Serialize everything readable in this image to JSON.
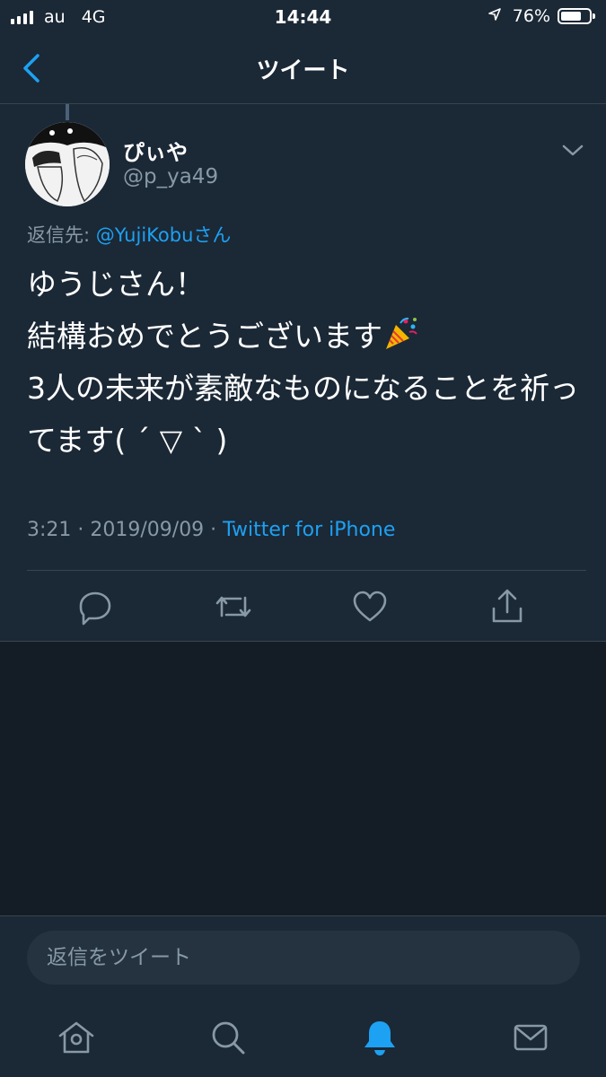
{
  "status_bar": {
    "carrier": "au",
    "network": "4G",
    "time": "14:44",
    "battery": "76%",
    "battery_level": 0.76
  },
  "header": {
    "title": "ツイート",
    "back_icon": "chevron-left-icon"
  },
  "tweet": {
    "display_name": "ぴぃや",
    "handle": "@p_ya49",
    "reply_prefix": "返信先: ",
    "reply_target": "@YujiKobu",
    "reply_suffix": "さん",
    "text_before_emoji": "ゆうじさん！\n結構おめでとうございます",
    "text_after_emoji": "\n3人の未来が素敵なものになることを祈ってます( ´ ▽ ` )",
    "emoji": "party-popper-icon",
    "timestamp": "3:21 · 2019/09/09 · ",
    "client": "Twitter for iPhone"
  },
  "actions": [
    "reply-icon",
    "retweet-icon",
    "like-icon",
    "share-icon"
  ],
  "composer": {
    "placeholder": "返信をツイート"
  },
  "tabs": [
    "home-icon",
    "search-icon",
    "notifications-icon",
    "messages-icon"
  ],
  "colors": {
    "background": "#141d26",
    "surface": "#1b2836",
    "accent": "#1da1f2",
    "secondary_text": "#8899a6",
    "divider": "#38444d"
  }
}
